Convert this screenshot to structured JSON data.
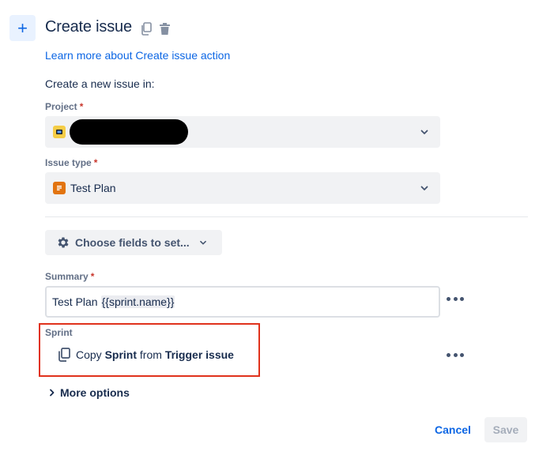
{
  "header": {
    "add_icon": "plus-icon",
    "title": "Create issue",
    "copy_icon": "copy-icon",
    "delete_icon": "trash-icon"
  },
  "learn_link": "Learn more about Create issue action",
  "intro_text": "Create a new issue in:",
  "project": {
    "label": "Project",
    "required": "*",
    "value": "",
    "icon": "project-avatar-icon"
  },
  "issue_type": {
    "label": "Issue type",
    "required": "*",
    "value": "Test Plan",
    "icon": "test-plan-icon"
  },
  "choose_fields": {
    "label": "Choose fields to set...",
    "icon": "gear-icon"
  },
  "summary": {
    "label": "Summary",
    "required": "*",
    "value_prefix": "Test Plan",
    "value_smart": "{{sprint.name}}"
  },
  "sprint": {
    "label": "Sprint",
    "copy_word": "Copy",
    "field_name": "Sprint",
    "from_word": "from",
    "source": "Trigger issue"
  },
  "more_options": "More options",
  "footer": {
    "cancel": "Cancel",
    "save": "Save"
  },
  "colors": {
    "primary": "#0c66e4",
    "highlight": "#e0321c",
    "required": "#c9372c"
  }
}
